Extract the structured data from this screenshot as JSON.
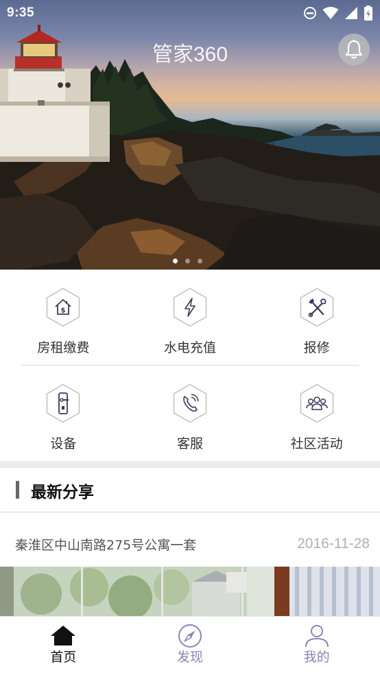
{
  "status_bar": {
    "time": "9:35"
  },
  "header": {
    "title": "管家360"
  },
  "banner": {
    "slide_count": 3,
    "active_slide": 1
  },
  "services": [
    {
      "label": "房租缴费",
      "icon": "rent-payment-icon"
    },
    {
      "label": "水电充值",
      "icon": "utility-recharge-icon"
    },
    {
      "label": "报修",
      "icon": "repair-icon"
    },
    {
      "label": "设备",
      "icon": "device-icon"
    },
    {
      "label": "客服",
      "icon": "customer-service-icon"
    },
    {
      "label": "社区活动",
      "icon": "community-event-icon"
    }
  ],
  "latest_share": {
    "title": "最新分享",
    "items": [
      {
        "title": "秦淮区中山南路275号公寓一套",
        "date": "2016-11-28"
      }
    ]
  },
  "tabs": [
    {
      "label": "首页",
      "icon": "home-icon",
      "active": true
    },
    {
      "label": "发现",
      "icon": "compass-icon",
      "active": false
    },
    {
      "label": "我的",
      "icon": "user-icon",
      "active": false
    }
  ],
  "colors": {
    "accent": "#8a84b5",
    "hex_stroke": "#bfbfbf",
    "icon_ink": "#3a3a5a"
  }
}
